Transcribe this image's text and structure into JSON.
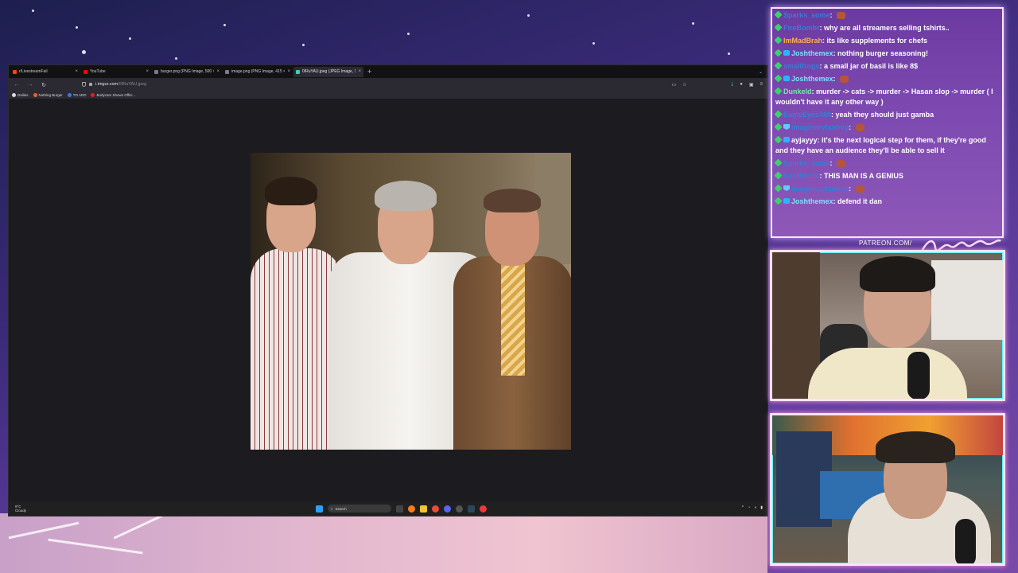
{
  "browser": {
    "tabs": [
      {
        "label": "r/LivestreamFail",
        "color": "#ff4500",
        "active": false
      },
      {
        "label": "YouTube",
        "color": "#ff0000",
        "active": false
      },
      {
        "label": "burger.png (PNG Image, 500 × 500 pi",
        "color": "#7a7a88",
        "active": false
      },
      {
        "label": "image.png (PNG Image, 415 × 177 pi",
        "color": "#7a7a88",
        "active": false
      },
      {
        "label": "0IRuYAU.jpeg (JPEG Image, 161",
        "color": "#3bd3a8",
        "active": true
      }
    ],
    "new_tab": "+",
    "tab_menu": "⌄",
    "url_host": "i.imgur.com",
    "url_path": "/0IRuYAU.jpeg",
    "bookmarks": [
      {
        "label": "Dailies",
        "color": "#d9d9de"
      },
      {
        "label": "Nothing Burger",
        "color": "#e8642c"
      },
      {
        "label": "TO ADD",
        "color": "#3a7bd5"
      },
      {
        "label": "Bodycam Shows Offici...",
        "color": "#e02020"
      }
    ]
  },
  "taskbar": {
    "weather_temp": "9°C",
    "weather_text": "Cloudy",
    "search_label": "Search"
  },
  "chat": {
    "messages": [
      {
        "user": "Sparks_some",
        "user_color": "#3a7bd5",
        "text": "",
        "emote": true,
        "badge": "mod"
      },
      {
        "user": "FireBombr",
        "user_color": "#3a7bd5",
        "text": "why are all streamers selling tshirts..",
        "emote": false,
        "badge": "mod"
      },
      {
        "user": "ImMadBrah",
        "user_color": "#ffb347",
        "text": "its like supplements for chefs",
        "emote": false,
        "badge": "mod"
      },
      {
        "user": "Joshthemex",
        "user_color": "#79e2ff",
        "text": "nothing burger seasoning!",
        "emote": false,
        "badge": "vip"
      },
      {
        "user": "smallfrogs",
        "user_color": "#3a7bd5",
        "text": "a small jar of basil is like 8$",
        "emote": false,
        "badge": "mod"
      },
      {
        "user": "Joshthemex",
        "user_color": "#79e2ff",
        "text": "",
        "emote": true,
        "badge": "vip"
      },
      {
        "user": "Dunkeld",
        "user_color": "#6cf0a0",
        "text": "murder -> cats -> murder -> Hasan slop -> murder ( I wouldn't have it any other way )",
        "emote": false,
        "badge": "mod"
      },
      {
        "user": "EagleEyes480",
        "user_color": "#3a7bd5",
        "text": "yeah they should just gamba",
        "emote": false,
        "badge": "mod"
      },
      {
        "user": "imaginaryfanboy",
        "user_color": "#3a7bd5",
        "text": "",
        "emote": true,
        "badge": "both"
      },
      {
        "user": "ayjayyy",
        "user_color": "#ffffff",
        "text": "it's the next logical step for them, if they're good and they have an audience they'll be able to sell it",
        "emote": false,
        "badge": "vip"
      },
      {
        "user": "Sparks_some",
        "user_color": "#3a7bd5",
        "text": "",
        "emote": true,
        "badge": "mod"
      },
      {
        "user": "FireBombr",
        "user_color": "#3a7bd5",
        "text": "THIS MAN IS A GENIUS",
        "emote": false,
        "badge": "mod"
      },
      {
        "user": "imaginaryfanboy",
        "user_color": "#3a7bd5",
        "text": "",
        "emote": true,
        "badge": "both"
      },
      {
        "user": "Joshthemex",
        "user_color": "#79e2ff",
        "text": "defend it dan",
        "emote": false,
        "badge": "vip"
      }
    ]
  },
  "overlay": {
    "patreon_text": "PATREON.COM/"
  }
}
